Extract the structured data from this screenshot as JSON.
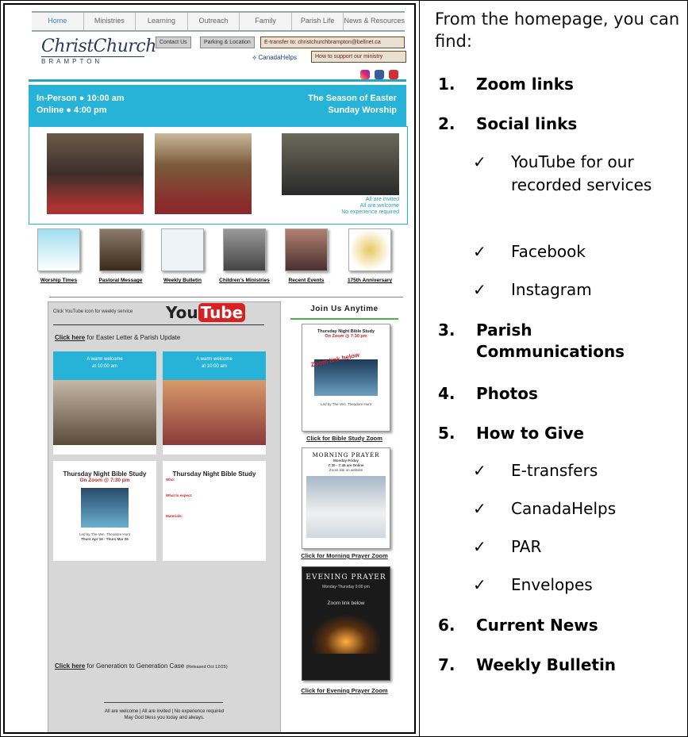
{
  "nav": [
    "Home",
    "Ministries",
    "Learning",
    "Outreach",
    "Family",
    "Parish Life",
    "News & Resources"
  ],
  "logo": {
    "main": "ChristChurch",
    "sub": "BRAMPTON"
  },
  "header_buttons": {
    "contact": "Contact Us",
    "parking": "Parking & Location",
    "etransfer": "E-transfer to: christchurchbrampton@bellnet.ca",
    "canadahelps": "CanadaHelps",
    "support": "How to support our ministry"
  },
  "banner": {
    "left_1": "In-Person ● 10:00 am",
    "left_2": "Online ● 4:00 pm",
    "right_1": "The Season of Easter",
    "right_2": "Sunday Worship"
  },
  "photo_caption": [
    "All are invited",
    "All are welcome",
    "No experience required"
  ],
  "tiles": [
    "Worship Times",
    "Pastoral Message",
    "Weekly Bulletin",
    "Children's Ministries",
    "Recent Events",
    "175th Anniversary"
  ],
  "youtube": {
    "note": "Click YouTube icon for weekly service",
    "logo_you": "You",
    "logo_tube": "Tube"
  },
  "left_links": {
    "easter_link": "Click here",
    "easter_rest": " for Easter Letter & Parish Update",
    "gen_link": "Click here",
    "gen_rest": " for Generation to Generation Case",
    "gen_note": "(Released Oct 12/25)"
  },
  "welcome_cards": {
    "line1": "A warm welcome",
    "line2": "at 10:00 am"
  },
  "bible_study": {
    "title": "Thursday Night Bible Study",
    "sub": "On Zoom @ 7:30 pm",
    "who": "Who:",
    "what": "What to expect:",
    "materials": "Materials:",
    "led": "Led by The Ven. Theodore Hunt",
    "dates": "Thurs Apr 16 - Thurs Mar 26"
  },
  "footer": {
    "line1": "All are welcome | All are invited | No experience required",
    "line2": "May God bless you today and always."
  },
  "right_col": {
    "join": "Join Us Anytime",
    "bible_link": "Click for Bible Study Zoom",
    "morning_title": "MORNING PRAYER",
    "morning_sub": "Monday-Friday",
    "morning_time": "7:30 - 7:45 am Online",
    "morning_zoom": "Zoom link on website",
    "morning_link": "Click for Morning Prayer Zoom",
    "evening_title": "EVENING PRAYER",
    "evening_sub": "Monday-Thursday 9:00 pm",
    "evening_zoom": "Zoom link below",
    "evening_link": "Click for Evening Prayer Zoom",
    "zoom_overlay": "Zoom link below"
  },
  "explainer": {
    "intro": "From the homepage, you can find:",
    "items": [
      {
        "num": "1.",
        "label": "Zoom links"
      },
      {
        "num": "2.",
        "label": "Social links"
      },
      {
        "num": "3.",
        "label": "Parish Communications"
      },
      {
        "num": "4.",
        "label": "Photos"
      },
      {
        "num": "5.",
        "label": "How to Give"
      },
      {
        "num": "6.",
        "label": "Current News"
      },
      {
        "num": "7.",
        "label": "Weekly Bulletin"
      }
    ],
    "check": "✓",
    "social_sub": [
      "YouTube for our recorded services",
      "Facebook",
      "Instagram"
    ],
    "give_sub": [
      "E-transfers",
      "CanadaHelps",
      "PAR",
      "Envelopes"
    ]
  }
}
